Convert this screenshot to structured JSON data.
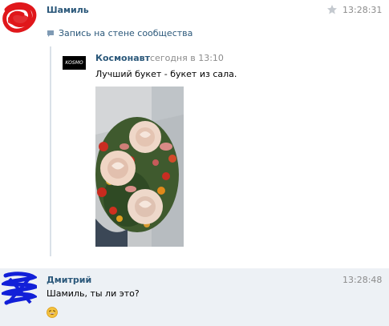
{
  "messages": [
    {
      "author": "Шамиль",
      "time": "13:28:31",
      "attachment_label": "Запись на стене сообщества",
      "repost": {
        "logo_text": "KOSMO",
        "author": "Космонавт",
        "time": "сегодня в 13:10",
        "text": "Лучший букет - букет из сала."
      }
    },
    {
      "author": "Дмитрий",
      "time": "13:28:48",
      "text": "Шамиль, ты ли это?",
      "emoji": "grinning-face"
    }
  ],
  "colors": {
    "link": "#2b587a",
    "time": "#8b8b8b",
    "highlight_bg": "#edf1f5"
  }
}
